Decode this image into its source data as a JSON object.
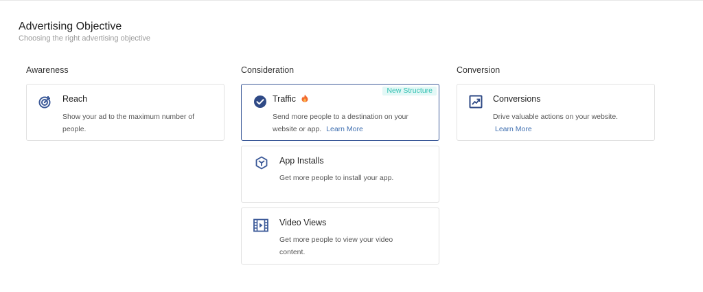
{
  "header": {
    "title": "Advertising Objective",
    "subtitle": "Choosing the right advertising objective"
  },
  "columns": [
    {
      "heading": "Awareness",
      "cards": [
        {
          "name": "Reach",
          "description": "Show your ad to the maximum number of people.",
          "icon": "target-icon"
        }
      ]
    },
    {
      "heading": "Consideration",
      "cards": [
        {
          "name": "Traffic",
          "description": "Send more people to a destination on your website or app.",
          "link": "Learn More",
          "badge": "New Structure",
          "icon": "check-circle-icon",
          "selected": true,
          "hot_icon": "flame-icon"
        },
        {
          "name": "App Installs",
          "description": "Get more people to install your app.",
          "icon": "cube-icon"
        },
        {
          "name": "Video Views",
          "description": "Get more people to view your video content.",
          "icon": "film-icon"
        }
      ]
    },
    {
      "heading": "Conversion",
      "cards": [
        {
          "name": "Conversions",
          "description": "Drive valuable actions on your website.",
          "link": "Learn More",
          "icon": "trend-icon"
        }
      ]
    }
  ],
  "colors": {
    "accent": "#3b5998",
    "link": "#3f6fb0",
    "badge_text": "#2dbfb0",
    "badge_bg": "#e3f8f6",
    "flame": "#f26a2e"
  }
}
